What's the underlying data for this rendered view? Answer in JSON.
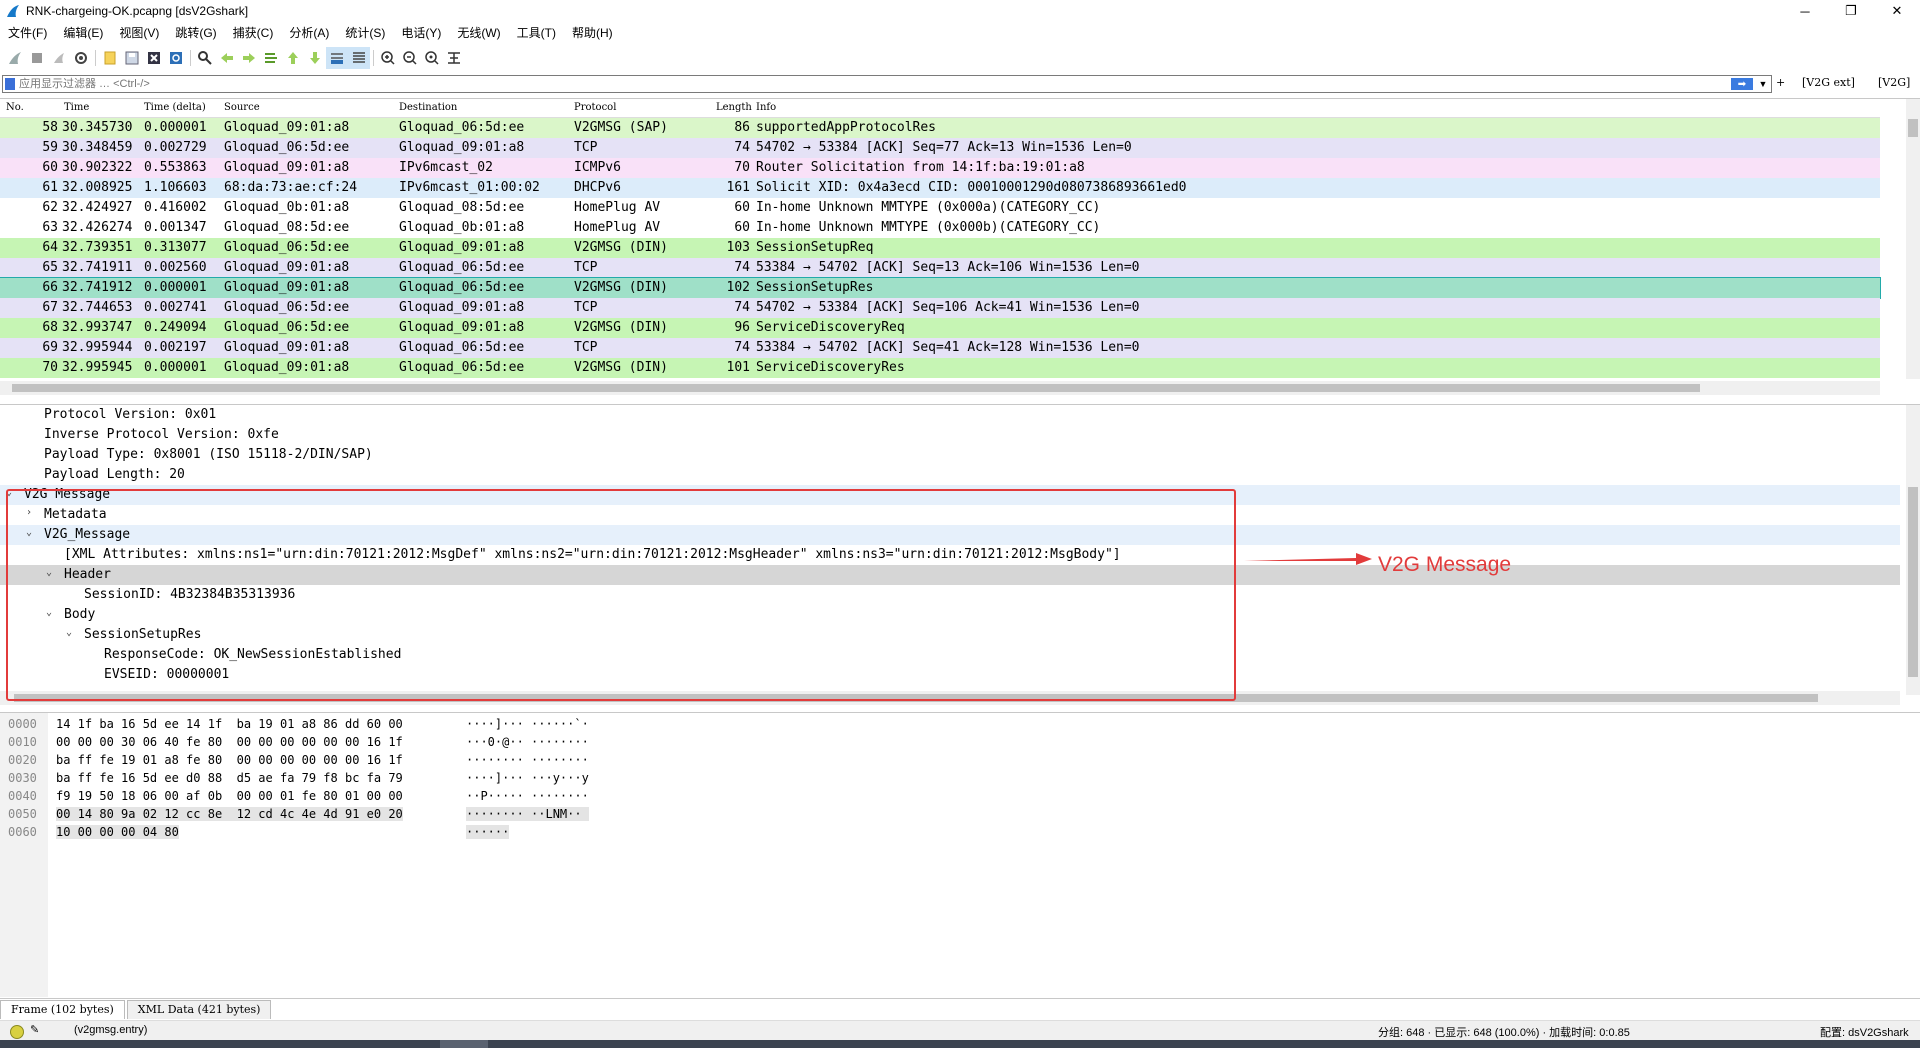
{
  "window": {
    "title": "RNK-chargeing-OK.pcapng [dsV2Gshark]",
    "controls": [
      "─",
      "❐",
      "✕"
    ]
  },
  "menu": [
    "文件(F)",
    "编辑(E)",
    "视图(V)",
    "跳转(G)",
    "捕获(C)",
    "分析(A)",
    "统计(S)",
    "电话(Y)",
    "无线(W)",
    "工具(T)",
    "帮助(H)"
  ],
  "filter": {
    "placeholder": "应用显示过滤器 … <Ctrl-/>",
    "buttons": [
      "+",
      "[V2G ext]",
      "[V2G]"
    ]
  },
  "packet_list": {
    "columns": [
      "No.",
      "Time",
      "Time (delta)",
      "Source",
      "Destination",
      "Protocol",
      "Length",
      "Info"
    ],
    "rows": [
      {
        "no": "58",
        "time": "30.345730",
        "delta": "0.000001",
        "src": "Gloquad_09:01:a8",
        "dst": "Gloquad_06:5d:ee",
        "proto": "V2GMSG (SAP)",
        "len": "86",
        "info": "supportedAppProtocolRes",
        "color": "#daf6c9"
      },
      {
        "no": "59",
        "time": "30.348459",
        "delta": "0.002729",
        "src": "Gloquad_06:5d:ee",
        "dst": "Gloquad_09:01:a8",
        "proto": "TCP",
        "len": "74",
        "info": "54702 → 53384 [ACK] Seq=77 Ack=13 Win=1536 Len=0",
        "color": "#e5e2f6"
      },
      {
        "no": "60",
        "time": "30.902322",
        "delta": "0.553863",
        "src": "Gloquad_09:01:a8",
        "dst": "IPv6mcast_02",
        "proto": "ICMPv6",
        "len": "70",
        "info": "Router Solicitation from 14:1f:ba:19:01:a8",
        "color": "#f9e1f8"
      },
      {
        "no": "61",
        "time": "32.008925",
        "delta": "1.106603",
        "src": "68:da:73:ae:cf:24",
        "dst": "IPv6mcast_01:00:02",
        "proto": "DHCPv6",
        "len": "161",
        "info": "Solicit XID: 0x4a3ecd CID: 00010001290d0807386893661ed0",
        "color": "#dcecfa"
      },
      {
        "no": "62",
        "time": "32.424927",
        "delta": "0.416002",
        "src": "Gloquad_0b:01:a8",
        "dst": "Gloquad_08:5d:ee",
        "proto": "HomePlug AV",
        "len": "60",
        "info": "In-home Unknown MMTYPE (0x000a)(CATEGORY_CC)",
        "color": "#ffffff"
      },
      {
        "no": "63",
        "time": "32.426274",
        "delta": "0.001347",
        "src": "Gloquad_08:5d:ee",
        "dst": "Gloquad_0b:01:a8",
        "proto": "HomePlug AV",
        "len": "60",
        "info": "In-home Unknown MMTYPE (0x000b)(CATEGORY_CC)",
        "color": "#ffffff"
      },
      {
        "no": "64",
        "time": "32.739351",
        "delta": "0.313077",
        "src": "Gloquad_06:5d:ee",
        "dst": "Gloquad_09:01:a8",
        "proto": "V2GMSG (DIN)",
        "len": "103",
        "info": "SessionSetupReq",
        "color": "#c6f5b4"
      },
      {
        "no": "65",
        "time": "32.741911",
        "delta": "0.002560",
        "src": "Gloquad_09:01:a8",
        "dst": "Gloquad_06:5d:ee",
        "proto": "TCP",
        "len": "74",
        "info": "53384 → 54702 [ACK] Seq=13 Ack=106 Win=1536 Len=0",
        "color": "#e5e2f6"
      },
      {
        "no": "66",
        "time": "32.741912",
        "delta": "0.000001",
        "src": "Gloquad_09:01:a8",
        "dst": "Gloquad_06:5d:ee",
        "proto": "V2GMSG (DIN)",
        "len": "102",
        "info": "SessionSetupRes",
        "color": "#9fe0c8",
        "selected": true
      },
      {
        "no": "67",
        "time": "32.744653",
        "delta": "0.002741",
        "src": "Gloquad_06:5d:ee",
        "dst": "Gloquad_09:01:a8",
        "proto": "TCP",
        "len": "74",
        "info": "54702 → 53384 [ACK] Seq=106 Ack=41 Win=1536 Len=0",
        "color": "#e5e2f6"
      },
      {
        "no": "68",
        "time": "32.993747",
        "delta": "0.249094",
        "src": "Gloquad_06:5d:ee",
        "dst": "Gloquad_09:01:a8",
        "proto": "V2GMSG (DIN)",
        "len": "96",
        "info": "ServiceDiscoveryReq",
        "color": "#c6f5b4"
      },
      {
        "no": "69",
        "time": "32.995944",
        "delta": "0.002197",
        "src": "Gloquad_09:01:a8",
        "dst": "Gloquad_06:5d:ee",
        "proto": "TCP",
        "len": "74",
        "info": "53384 → 54702 [ACK] Seq=41 Ack=128 Win=1536 Len=0",
        "color": "#e5e2f6"
      },
      {
        "no": "70",
        "time": "32.995945",
        "delta": "0.000001",
        "src": "Gloquad_09:01:a8",
        "dst": "Gloquad_06:5d:ee",
        "proto": "V2GMSG (DIN)",
        "len": "101",
        "info": "ServiceDiscoveryRes",
        "color": "#c6f5b4"
      }
    ]
  },
  "details": [
    {
      "text": "Protocol Version: 0x01",
      "indent": 2,
      "expander": ""
    },
    {
      "text": "Inverse Protocol Version: 0xfe",
      "indent": 2,
      "expander": ""
    },
    {
      "text": "Payload Type: 0x8001 (ISO 15118-2/DIN/SAP)",
      "indent": 2,
      "expander": ""
    },
    {
      "text": "Payload Length: 20",
      "indent": 2,
      "expander": ""
    },
    {
      "text": "V2G Message",
      "indent": 1,
      "expander": "⌄",
      "hl": "hl1"
    },
    {
      "text": "Metadata",
      "indent": 2,
      "expander": "›"
    },
    {
      "text": "V2G_Message",
      "indent": 2,
      "expander": "⌄",
      "hl": "hl1"
    },
    {
      "text": "[XML Attributes:  xmlns:ns1=\"urn:din:70121:2012:MsgDef\" xmlns:ns2=\"urn:din:70121:2012:MsgHeader\" xmlns:ns3=\"urn:din:70121:2012:MsgBody\"]",
      "indent": 3,
      "expander": ""
    },
    {
      "text": "Header",
      "indent": 3,
      "expander": "⌄",
      "hl": "hl2"
    },
    {
      "text": "SessionID: 4B32384B35313936",
      "indent": 4,
      "expander": ""
    },
    {
      "text": "Body",
      "indent": 3,
      "expander": "⌄"
    },
    {
      "text": "SessionSetupRes",
      "indent": 4,
      "expander": "⌄"
    },
    {
      "text": "ResponseCode: OK_NewSessionEstablished",
      "indent": 5,
      "expander": ""
    },
    {
      "text": "EVSEID: 00000001",
      "indent": 5,
      "expander": ""
    }
  ],
  "annotation": {
    "label": "V2G Message",
    "color": "#e23b3b"
  },
  "bytes": [
    {
      "off": "0000",
      "hex": "14 1f ba 16 5d ee 14 1f  ba 19 01 a8 86 dd 60 00",
      "asc": "····]··· ······`·"
    },
    {
      "off": "0010",
      "hex": "00 00 00 30 06 40 fe 80  00 00 00 00 00 00 16 1f",
      "asc": "···0·@·· ········"
    },
    {
      "off": "0020",
      "hex": "ba ff fe 19 01 a8 fe 80  00 00 00 00 00 00 16 1f",
      "asc": "········ ········"
    },
    {
      "off": "0030",
      "hex": "ba ff fe 16 5d ee d0 88  d5 ae fa 79 f8 bc fa 79",
      "asc": "····]··· ···y···y"
    },
    {
      "off": "0040",
      "hex": "f9 19 50 18 06 00 af 0b  00 00 01 fe 80 01 00 00",
      "asc": "··P····· ········"
    },
    {
      "off": "0050",
      "hex": "00 14 80 9a 02 12 cc 8e  12 cd 4c 4e 4d 91 e0 20",
      "asc": "········ ··LNM·· "
    },
    {
      "off": "0060",
      "hex": "10 00 00 00 04 80",
      "asc": "······"
    }
  ],
  "tabs": [
    "Frame (102 bytes)",
    "XML Data (421 bytes)"
  ],
  "status": {
    "field": "(v2gmsg.entry)",
    "packets": "分组: 648 · 已显示: 648 (100.0%) · 加载时间: 0:0.85",
    "profile": "配置: dsV2Gshark"
  }
}
